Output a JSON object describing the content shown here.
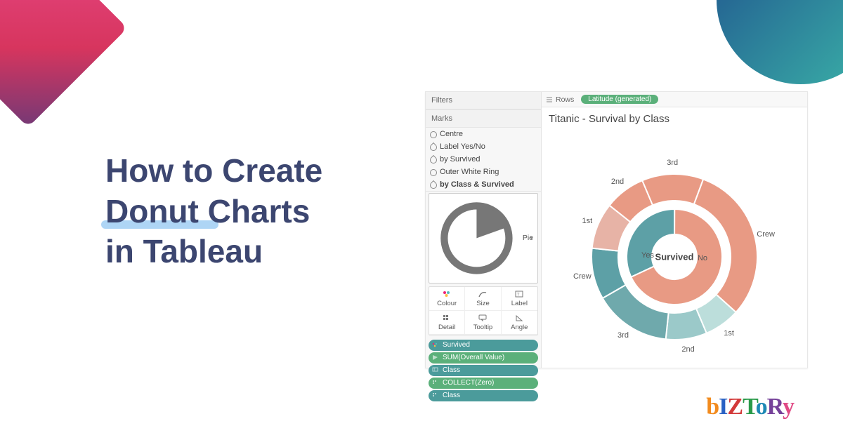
{
  "headline": {
    "line1": "How to Create",
    "line2": "Donut Charts",
    "line3": "in Tableau"
  },
  "tableau": {
    "rows_label": "Rows",
    "rows_pill": "Latitude (generated)",
    "filters_header": "Filters",
    "marks_header": "Marks",
    "marks": {
      "centre": "Centre",
      "label_yesno": "Label Yes/No",
      "by_survived": "by Survived",
      "outer_white": "Outer White Ring",
      "by_class_survived": "by Class & Survived"
    },
    "dropdown": "Pie",
    "cards": {
      "colour": "Colour",
      "size": "Size",
      "label": "Label",
      "detail": "Detail",
      "tooltip": "Tooltip",
      "angle": "Angle"
    },
    "pills": {
      "survived": "Survived",
      "sum_overall": "SUM(Overall Value)",
      "class1": "Class",
      "collect_zero": "COLLECT(Zero)",
      "class2": "Class"
    },
    "viz_title": "Titanic - Survival by Class"
  },
  "donut_labels": {
    "center": "Survived",
    "inner_yes": "Yes",
    "inner_no": "No",
    "outer": {
      "crew_top": "Crew",
      "first_top": "1st",
      "second_right": "2nd",
      "third_right": "3rd",
      "crew_bottom": "Crew",
      "first_left": "1st",
      "second_left": "2nd",
      "third_left": "3rd"
    }
  },
  "chart_data": {
    "type": "pie",
    "title": "Titanic - Survival by Class",
    "rings": [
      {
        "name": "Survived (inner)",
        "series": [
          {
            "name": "Yes",
            "value": 32,
            "color": "#5da0a6"
          },
          {
            "name": "No",
            "value": 68,
            "color": "#e89a84"
          }
        ]
      },
      {
        "name": "Class & Survived (outer)",
        "series": [
          {
            "name": "Crew (Yes)",
            "value": 10,
            "color": "#5da0a6"
          },
          {
            "name": "1st (Yes)",
            "value": 9,
            "color": "#e7b3a6"
          },
          {
            "name": "2nd (Yes)",
            "value": 8,
            "color": "#e89a84"
          },
          {
            "name": "3rd (Yes)",
            "value": 12,
            "color": "#e89a84"
          },
          {
            "name": "Crew (No)",
            "value": 31,
            "color": "#e89a84"
          },
          {
            "name": "1st (No)",
            "value": 7,
            "color": "#bcdedb"
          },
          {
            "name": "2nd (No)",
            "value": 8,
            "color": "#9bc9c9"
          },
          {
            "name": "3rd (No)",
            "value": 15,
            "color": "#6fa9ac"
          }
        ]
      }
    ]
  },
  "logo": {
    "b": "b",
    "i": "I",
    "z": "Z",
    "t": "T",
    "o": "o",
    "r": "R",
    "y": "y"
  }
}
